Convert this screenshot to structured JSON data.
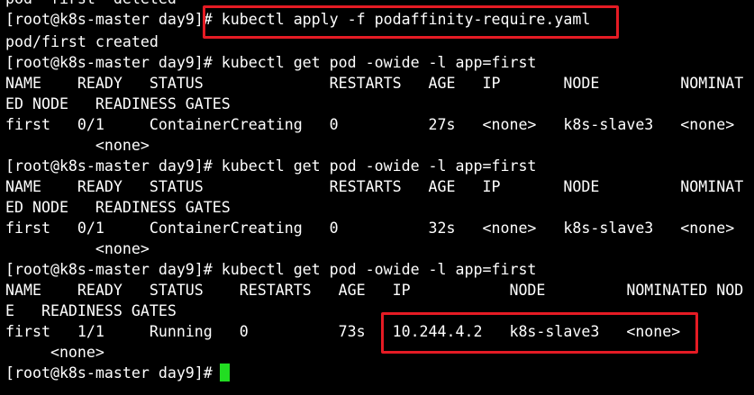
{
  "terminal": {
    "lines": [
      "pod \"first\" deleted",
      "[root@k8s-master day9]# kubectl apply -f podaffinity-require.yaml",
      "pod/first created",
      "[root@k8s-master day9]# kubectl get pod -owide -l app=first",
      "NAME    READY   STATUS              RESTARTS   AGE   IP       NODE         NOMINAT",
      "ED NODE   READINESS GATES",
      "first   0/1     ContainerCreating   0          27s   <none>   k8s-slave3   <none>",
      "          <none>",
      "[root@k8s-master day9]# kubectl get pod -owide -l app=first",
      "NAME    READY   STATUS              RESTARTS   AGE   IP       NODE         NOMINAT",
      "ED NODE   READINESS GATES",
      "first   0/1     ContainerCreating   0          32s   <none>   k8s-slave3   <none>",
      "          <none>",
      "[root@k8s-master day9]# kubectl get pod -owide -l app=first",
      "NAME    READY   STATUS    RESTARTS   AGE   IP           NODE         NOMINATED NOD",
      "E   READINESS GATES",
      "first   1/1     Running   0          73s   10.244.4.2   k8s-slave3   <none>",
      "     <none>",
      "[root@k8s-master day9]# "
    ]
  },
  "colors": {
    "background": "#000000",
    "text": "#ffffff",
    "highlight": "#e51b24",
    "cursor": "#22dd22"
  }
}
